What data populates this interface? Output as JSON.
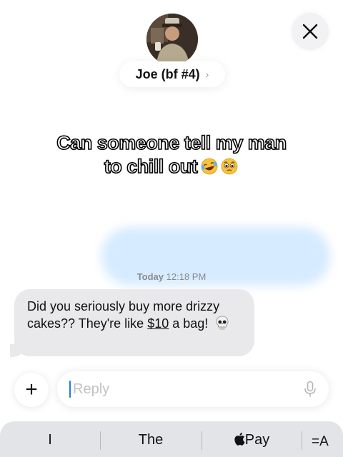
{
  "header": {
    "contact_name": "Joe (bf #4)",
    "chevron": "›",
    "close_icon": "close-icon",
    "avatar_icon": "avatar-photo"
  },
  "caption": {
    "line1": "Can someone tell my man",
    "line2": "to chill out",
    "emojis": [
      "laughing-crying-emoji",
      "pleading-face-emoji"
    ]
  },
  "thread": {
    "timestamp_day": "Today",
    "timestamp_time": "12:18 PM",
    "message": {
      "text_part1": "Did you seriously buy more drizzy cakes?? They're like ",
      "link": "$10",
      "text_part2": " a bag!",
      "emoji": "skull-emoji"
    }
  },
  "composer": {
    "plus_label": "+",
    "placeholder": "Reply",
    "mic_icon": "microphone-icon"
  },
  "keyboard": {
    "suggestions": [
      "I",
      "The",
      "Pay"
    ],
    "apple_icon": "apple-logo-icon",
    "format_label": "=A"
  },
  "colors": {
    "bubble_gray": "#e9e9eb",
    "blurred_bubble": "#d6ebff",
    "caret_blue": "#1c7cf2",
    "keyboard_bg": "#e3e4e8"
  }
}
